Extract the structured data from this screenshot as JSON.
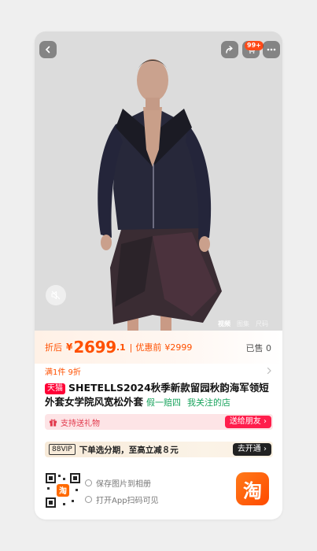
{
  "hero": {
    "cart_badge": "99+",
    "media_tabs": [
      "视频",
      "图集",
      "尺码"
    ]
  },
  "price": {
    "label": "折后",
    "currency": "¥",
    "value": "2699",
    "value_decimal": ".1",
    "separator": "|",
    "original_label": "优惠前",
    "original_value": "¥2999",
    "sold": "已售 0"
  },
  "discount": {
    "text": "满1件 9折"
  },
  "product": {
    "badge": "天猫",
    "title": "SHETELLS2024秋季新款留园秋韵海军领短外套女学院风宽松外套",
    "tag_guarantee": "假一赔四",
    "tag_store": "我关注的店"
  },
  "gift": {
    "text": "支持送礼物",
    "button": "送给朋友 ›"
  },
  "vip": {
    "badge": "88VIP",
    "text": "下单选分期，至高立减８元",
    "button": "去开通 ›"
  },
  "bottom": {
    "hint_save": "保存图片到相册",
    "hint_scan": "打开App扫码可见",
    "app_logo": "淘"
  },
  "colors": {
    "accent": "#ff5000",
    "tmall": "#ff0036",
    "gift_bg": "#fde4e6",
    "vip_bg": "#f7ead8",
    "green": "#17a35c"
  }
}
